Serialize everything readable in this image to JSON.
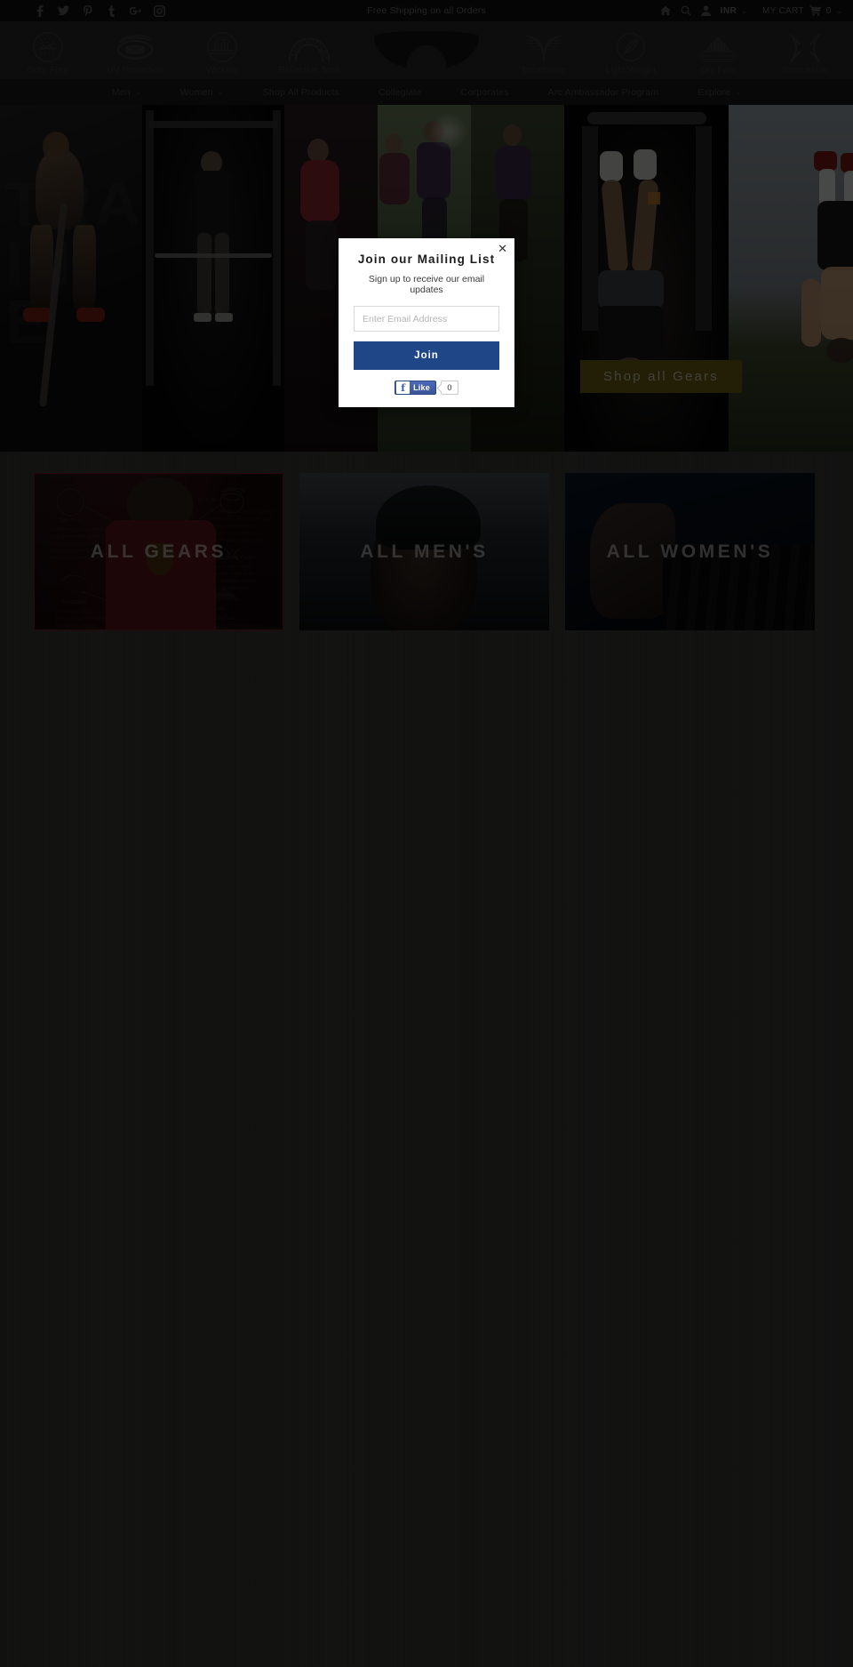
{
  "topbar": {
    "social": [
      {
        "name": "facebook-icon",
        "glyph": "f"
      },
      {
        "name": "twitter-icon",
        "glyph": "t"
      },
      {
        "name": "pinterest-icon",
        "glyph": "p"
      },
      {
        "name": "tumblr-icon",
        "glyph": "t"
      },
      {
        "name": "google-plus-icon",
        "glyph": "g+"
      },
      {
        "name": "instagram-icon",
        "glyph": "ig"
      }
    ],
    "announcement": "Free Shipping on all Orders",
    "currency": "INR",
    "cart_label": "MY CART",
    "cart_count": "0",
    "chevron": "⌄"
  },
  "features": {
    "left": [
      {
        "label": "Odor Free",
        "icon": "odor-free-icon"
      },
      {
        "label": "UV Protection",
        "icon": "uv-protection-icon"
      },
      {
        "label": "Wicking",
        "icon": "wicking-icon"
      },
      {
        "label": "Reflective Tech",
        "icon": "reflective-tech-icon"
      }
    ],
    "right": [
      {
        "label": "Breathable",
        "icon": "breathable-icon"
      },
      {
        "label": "Light Weight",
        "icon": "light-weight-icon"
      },
      {
        "label": "Dry Fast",
        "icon": "dry-fast-icon"
      },
      {
        "label": "Stretchable",
        "icon": "stretchable-icon"
      }
    ]
  },
  "nav": {
    "items": [
      {
        "label": "Men",
        "has_dropdown": true
      },
      {
        "label": "Women",
        "has_dropdown": true
      },
      {
        "label": "Shop All Products",
        "has_dropdown": false
      },
      {
        "label": "Collegiate",
        "has_dropdown": false
      },
      {
        "label": "Corporates",
        "has_dropdown": false
      },
      {
        "label": "Arc Ambassador Program",
        "has_dropdown": false
      },
      {
        "label": "Explore",
        "has_dropdown": true
      }
    ],
    "chevron": "⌄"
  },
  "hero": {
    "ghost_text": "TRA\nIN\nE",
    "cta_label": "Shop all Gears",
    "cta_bg": "#6a6014"
  },
  "categories": [
    {
      "title": "ALL GEARS",
      "name": "category-card-all-gears"
    },
    {
      "title": "ALL MEN'S",
      "name": "category-card-all-mens"
    },
    {
      "title": "ALL WOMEN'S",
      "name": "category-card-all-womens"
    }
  ],
  "modal": {
    "title": "Join our Mailing List",
    "subtitle": "Sign up to receive our email updates",
    "email_value": "",
    "email_placeholder": "Enter Email Address",
    "join_label": "Join",
    "join_bg": "#1f4788",
    "close_glyph": "✕",
    "facebook": {
      "f_glyph": "f",
      "like_label": "Like",
      "count": "0"
    }
  }
}
